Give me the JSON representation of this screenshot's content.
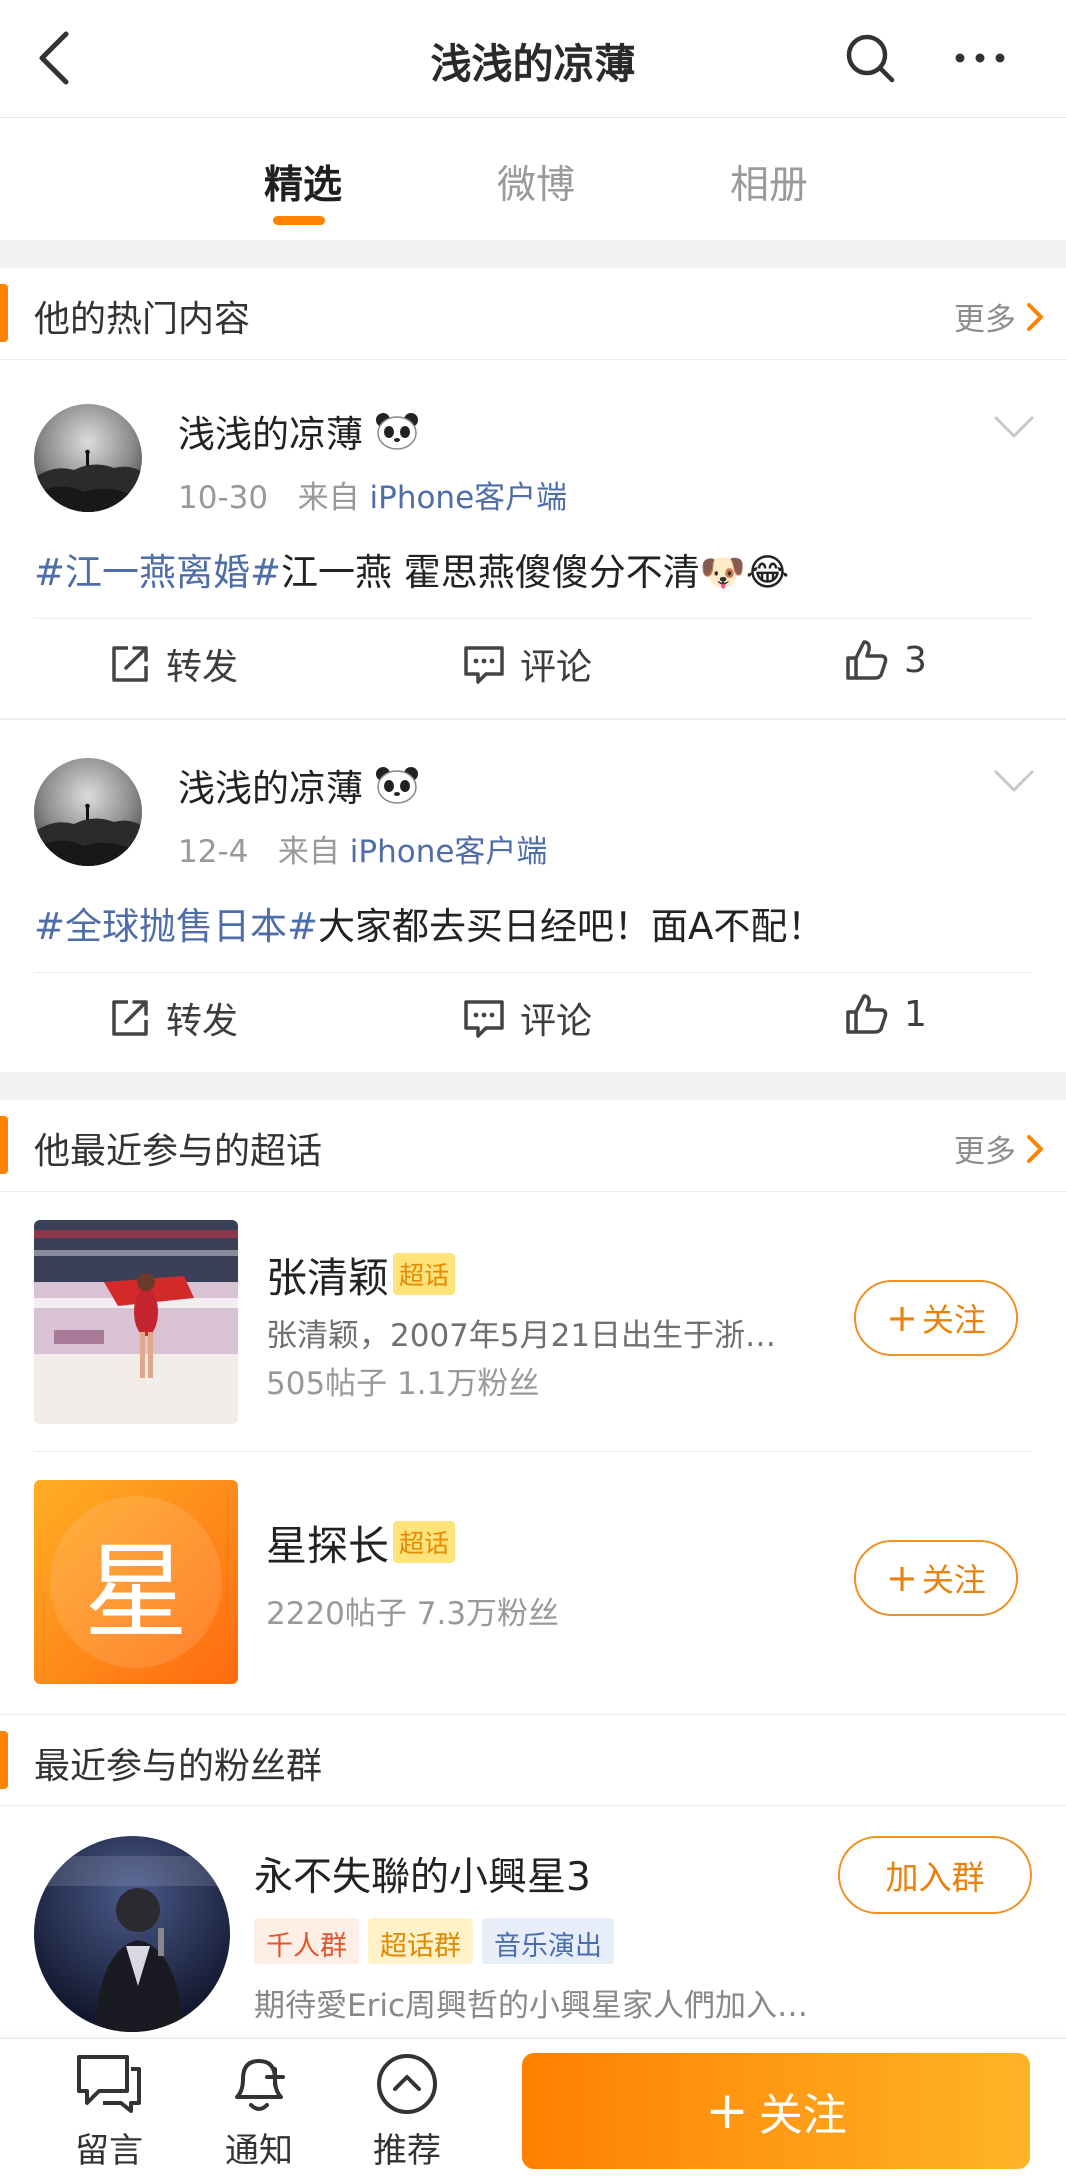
{
  "header": {
    "title": "浅浅的凉薄"
  },
  "tabs": [
    {
      "label": "精选",
      "active": true
    },
    {
      "label": "微博",
      "active": false
    },
    {
      "label": "相册",
      "active": false
    }
  ],
  "hot_section": {
    "title": "他的热门内容",
    "more": "更多"
  },
  "posts": [
    {
      "username": "浅浅的凉薄",
      "date": "10-30",
      "from": "来自",
      "source": "iPhone客户端",
      "tag": "#江一燕离婚#",
      "text": "江一燕 霍思燕傻傻分不清",
      "emoji": "🐶😂",
      "repost": "转发",
      "comment": "评论",
      "likes": "3"
    },
    {
      "username": "浅浅的凉薄",
      "date": "12-4",
      "from": "来自",
      "source": "iPhone客户端",
      "tag": "#全球抛售日本#",
      "text": "大家都去买日经吧！面A不配！",
      "emoji": "",
      "repost": "转发",
      "comment": "评论",
      "likes": "1"
    }
  ],
  "supertopic_section": {
    "title": "他最近参与的超话",
    "more": "更多"
  },
  "supertopics": [
    {
      "name": "张清颖",
      "badge": "超话",
      "desc": "张清颖，2007年5月21日出生于浙…",
      "stats": "505帖子 1.1万粉丝",
      "follow": "关注"
    },
    {
      "name": "星探长",
      "badge": "超话",
      "thumb_char": "星",
      "stats": "2220帖子 7.3万粉丝",
      "follow": "关注"
    }
  ],
  "fan_section": {
    "title": "最近参与的粉丝群"
  },
  "fan_group": {
    "name": "永不失聯的小興星3",
    "tags": [
      "千人群",
      "超话群",
      "音乐演出"
    ],
    "desc": "期待愛Eric周興哲的小興星家人們加入…",
    "join": "加入群"
  },
  "bottom": {
    "message": "留言",
    "notify": "通知",
    "recommend": "推荐",
    "follow": "关注"
  },
  "colors": {
    "accent": "#ff8200",
    "link": "#4f6da8",
    "badge_bg": "#ffe27a"
  }
}
